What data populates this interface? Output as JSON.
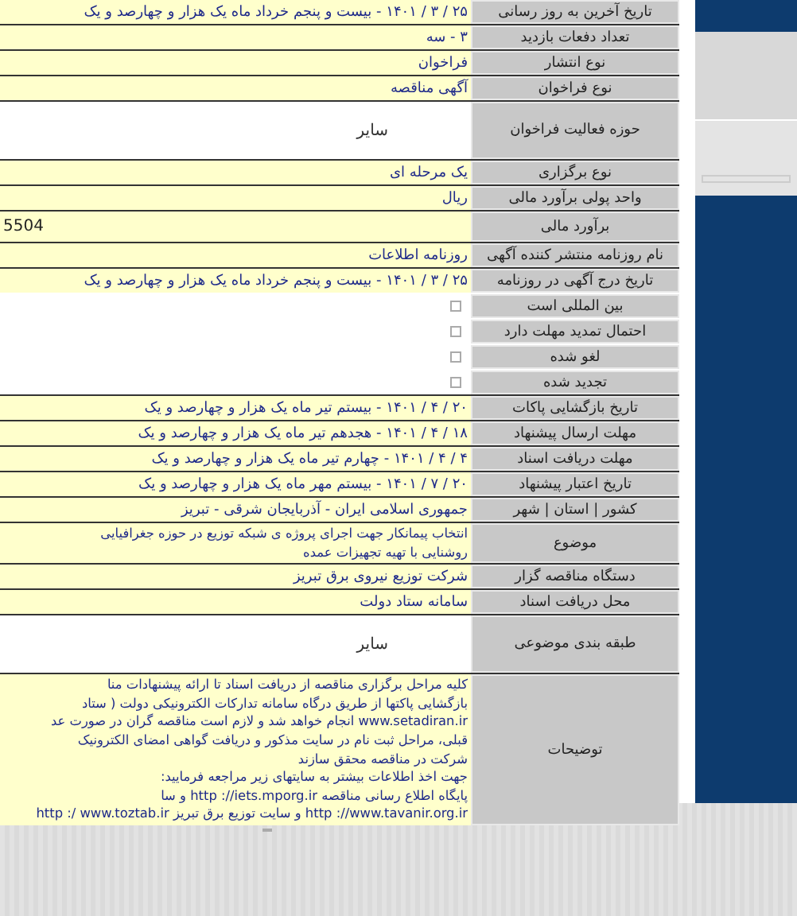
{
  "rows": [
    {
      "label": "تاریخ آخرین به روز رسانی",
      "kind": "text",
      "value": "۲۵ / ۳ / ۱۴۰۱ - بیست و پنجم خرداد ماه یک هزار و چهارصد و یک"
    },
    {
      "label": "تعداد دفعات بازدید",
      "kind": "text",
      "value": "۳ - سه"
    },
    {
      "label": "نوع انتشار",
      "kind": "text",
      "value": "فراخوان"
    },
    {
      "label": "نوع فراخوان",
      "kind": "text",
      "value": "آگهی مناقصه"
    },
    {
      "label": "حوزه فعالیت فراخوان",
      "kind": "tall",
      "value": "سایر"
    },
    {
      "label": "نوع برگزاری",
      "kind": "text",
      "value": "یک مرحله ای"
    },
    {
      "label": "واحد پولی برآورد مالی",
      "kind": "text",
      "value": "ریال"
    },
    {
      "label": "برآورد مالی",
      "kind": "number",
      "value": "5504"
    },
    {
      "label": "نام روزنامه منتشر کننده آگهی",
      "kind": "text",
      "value": "روزنامه اطلاعات"
    },
    {
      "label": "تاریخ درج آگهی در روزنامه",
      "kind": "text",
      "value": "۲۵ / ۳ / ۱۴۰۱ - بیست و پنجم خرداد ماه یک هزار و چهارصد و یک"
    },
    {
      "label": "بین المللی است",
      "kind": "checkbox",
      "checked": false
    },
    {
      "label": "احتمال تمدید مهلت دارد",
      "kind": "checkbox",
      "checked": false
    },
    {
      "label": "لغو شده",
      "kind": "checkbox",
      "checked": false
    },
    {
      "label": "تجدید شده",
      "kind": "checkbox",
      "checked": false
    },
    {
      "label": "تاریخ بازگشایی پاکات",
      "kind": "text",
      "value": "۲۰ / ۴ / ۱۴۰۱ - بیستم تیر ماه یک هزار و چهارصد و یک"
    },
    {
      "label": "مهلت ارسال پیشنهاد",
      "kind": "text",
      "value": "۱۸ / ۴ / ۱۴۰۱ - هجدهم تیر ماه یک هزار و چهارصد و یک"
    },
    {
      "label": "مهلت دریافت اسناد",
      "kind": "text",
      "value": "۴ / ۴ / ۱۴۰۱ - چهارم تیر ماه یک هزار و چهارصد و یک"
    },
    {
      "label": "تاریخ اعتبار پیشنهاد",
      "kind": "text",
      "value": "۲۰ / ۷ / ۱۴۰۱ - بیستم مهر ماه یک هزار و چهارصد و یک"
    },
    {
      "label": "کشور | استان | شهر",
      "kind": "text",
      "value": "جمهوری اسلامی ایران - آذربایجان شرقی - تبریز"
    },
    {
      "label": "موضوع",
      "kind": "lines",
      "lines": [
        "انتخاب پیمانکار جهت اجرای پروژه ی شبکه توزیع در حوزه جغرافیایی",
        "روشنایی با تهیه تجهیزات عمده"
      ]
    },
    {
      "label": "دستگاه مناقصه گزار",
      "kind": "text",
      "value": "شرکت توزیع نیروی برق تبریز"
    },
    {
      "label": "محل دریافت اسناد",
      "kind": "text",
      "value": "سامانه ستاد دولت"
    },
    {
      "label": "طبقه بندی موضوعی",
      "kind": "tall",
      "value": "سایر"
    },
    {
      "label": "توضیحات",
      "kind": "lines",
      "lines": [
        "کلیه مراحل برگزاری مناقصه از دریافت اسناد تا ارائه پیشنهادات منا",
        "بازگشایی پاکتها از طریق درگاه سامانه تدارکات الکترونیکی دولت ( ستاد",
        "www.setadiran.ir انجام خواهد شد و لازم است مناقصه گران در صورت عد",
        "قبلی، مراحل ثبت نام در سایت مذکور و دریافت گواهی امضای الکترونیک",
        "شرکت در مناقصه محقق سازند",
        "جهت اخذ اطلاعات بیشتر به سایتهای زیر مراجعه فرمایید:",
        "پایگاه اطلاع رسانی مناقصه http ://iets.mporg.ir و سا",
        "http ://www.tavanir.org.ir و سایت توزیع برق تبریز http :/ www.toztab.ir"
      ]
    }
  ]
}
